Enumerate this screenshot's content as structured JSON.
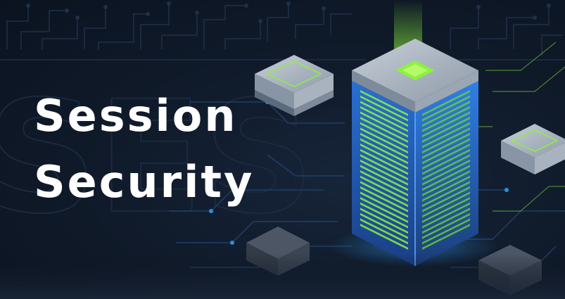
{
  "banner": {
    "title_line1": "Session",
    "title_line2": "Security"
  },
  "colors": {
    "background": "#0d1522",
    "accent_green": "#8cf23a",
    "accent_blue": "#2b8fe0",
    "circuit_line": "#1e3048"
  },
  "icons": [
    "server-rack-icon",
    "chip-icon",
    "circuit-board-pattern"
  ]
}
